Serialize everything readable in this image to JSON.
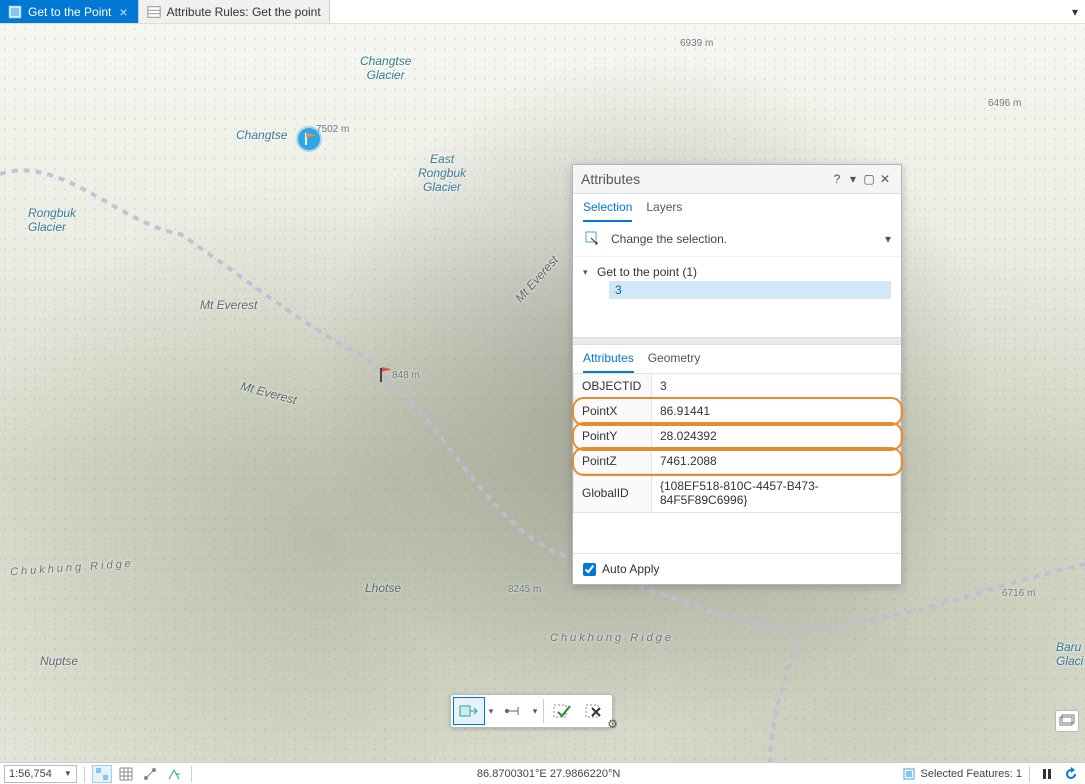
{
  "tabs": {
    "active": {
      "label": "Get to the Point"
    },
    "second": {
      "label": "Attribute Rules: Get the point"
    }
  },
  "map": {
    "labels": {
      "changtse_glacier": "Changtse\nGlacier",
      "changtse": "Changtse",
      "changtse_elev": "7502 m",
      "east_rongbuk": "East\nRongbuk\nGlacier",
      "rongbuk": "Rongbuk\nGlacier",
      "mt_everest1": "Mt Everest",
      "mt_everest2": "Mt Everest",
      "mt_everest3": "Mt Everest",
      "flag_elev": "848 m",
      "lhotse": "Lhotse",
      "lhotse_elev": "8245 m",
      "nuptse": "Nuptse",
      "chukhung_ridge1": "Chukhung Ridge",
      "chukhung_ridge2": "Chukhung Ridge",
      "elev_6939": "6939 m",
      "elev_6496": "6496 m",
      "elev_6716": "6716 m",
      "baru_glacier": "Baru\nGlaci"
    }
  },
  "attributes_panel": {
    "title": "Attributes",
    "tabs": {
      "selection": "Selection",
      "layers": "Layers"
    },
    "change_selection": "Change the selection.",
    "tree": {
      "parent": "Get to the point (1)",
      "child": "3"
    },
    "subtabs": {
      "attributes": "Attributes",
      "geometry": "Geometry"
    },
    "rows": {
      "objectid": {
        "k": "OBJECTID",
        "v": "3"
      },
      "pointx": {
        "k": "PointX",
        "v": "86.91441"
      },
      "pointy": {
        "k": "PointY",
        "v": "28.024392"
      },
      "pointz": {
        "k": "PointZ",
        "v": "7461.2088"
      },
      "globalid": {
        "k": "GlobalID",
        "v": "{108EF518-810C-4457-B473-84F5F89C6996}"
      }
    },
    "auto_apply": "Auto Apply"
  },
  "statusbar": {
    "scale": "1:56,754",
    "coords": "86.8700301°E 27.9866220°N",
    "selected": "Selected Features: 1"
  }
}
